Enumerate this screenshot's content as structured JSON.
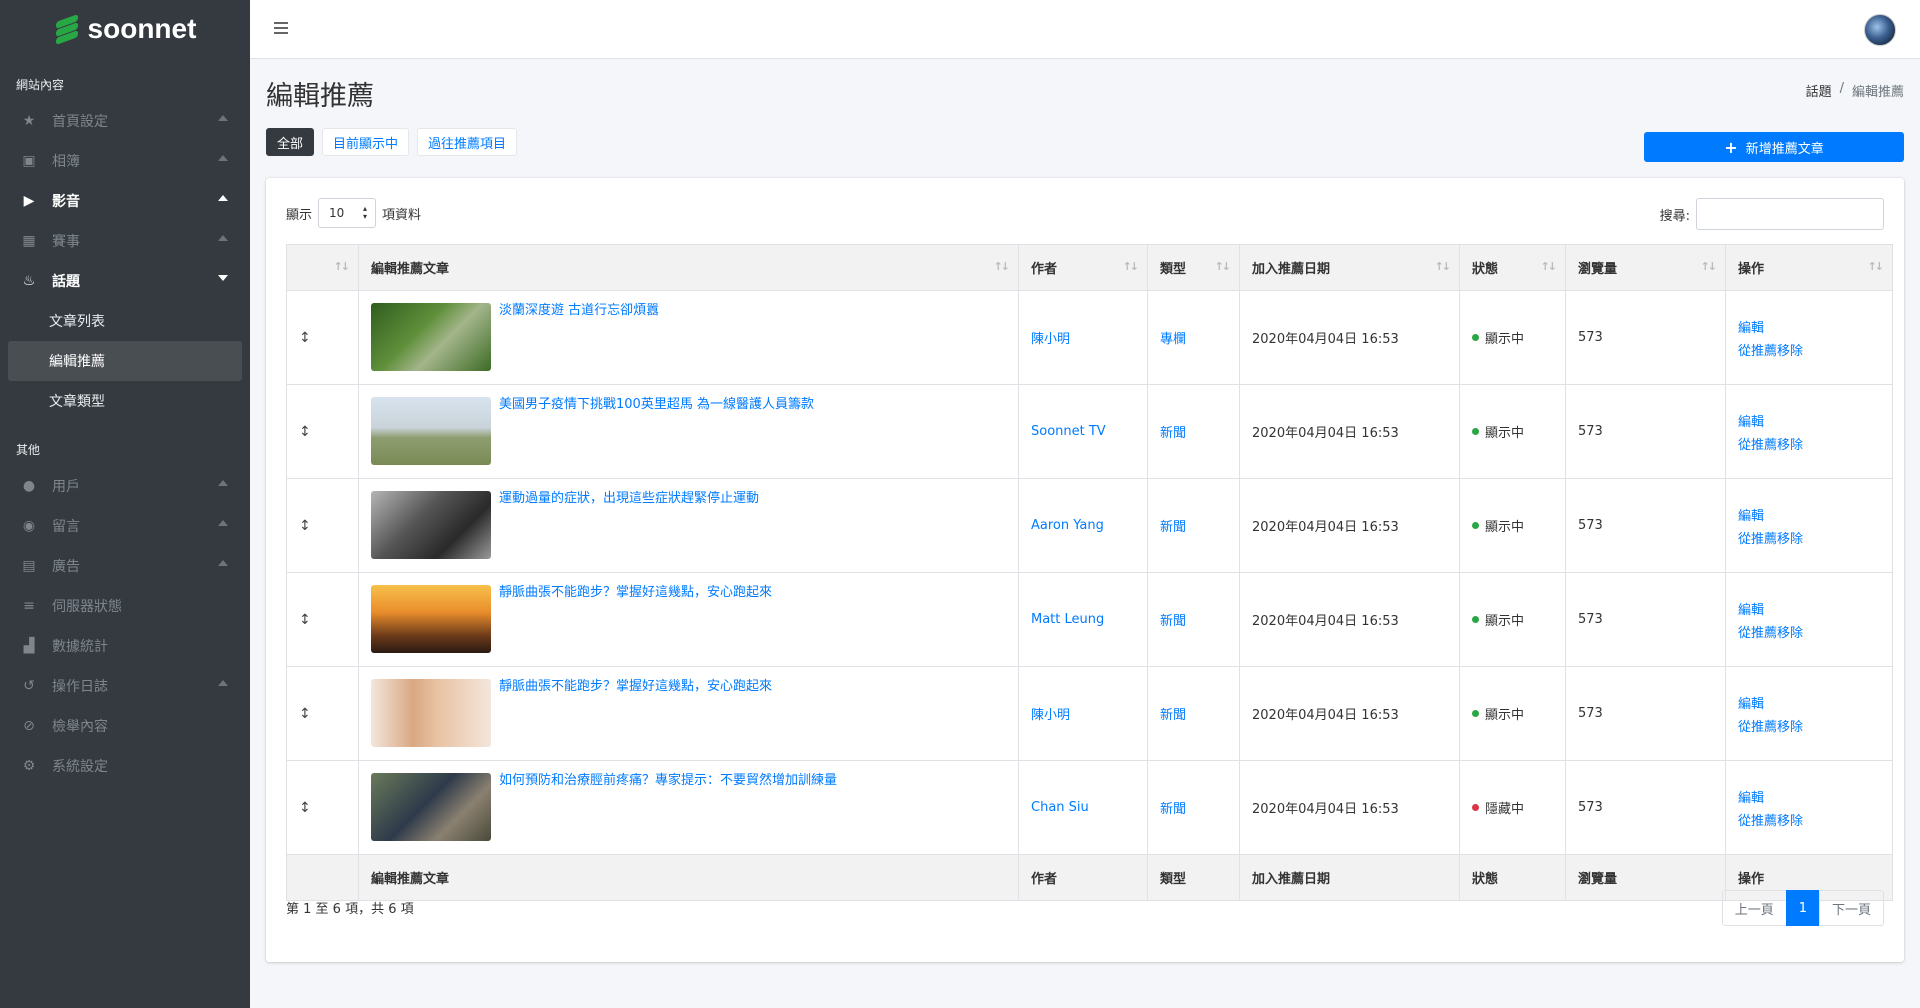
{
  "brand": {
    "name": "soonnet"
  },
  "sidebar": {
    "section1": "網站內容",
    "items1": [
      {
        "label": "首頁設定",
        "icon": "star-icon"
      },
      {
        "label": "相簿",
        "icon": "photos-icon"
      },
      {
        "label": "影音",
        "icon": "play-circle-icon"
      },
      {
        "label": "賽事",
        "icon": "calendar-icon"
      },
      {
        "label": "話題",
        "icon": "fire-icon"
      }
    ],
    "sub": [
      {
        "label": "文章列表"
      },
      {
        "label": "編輯推薦"
      },
      {
        "label": "文章類型"
      }
    ],
    "section2": "其他",
    "items2": [
      {
        "label": "用戶",
        "icon": "user-icon"
      },
      {
        "label": "留言",
        "icon": "comment-icon"
      },
      {
        "label": "廣告",
        "icon": "ad-icon"
      },
      {
        "label": "伺服器狀態",
        "icon": "server-icon"
      },
      {
        "label": "數據統計",
        "icon": "chart-icon"
      },
      {
        "label": "操作日誌",
        "icon": "history-icon"
      },
      {
        "label": "檢舉內容",
        "icon": "ban-icon"
      },
      {
        "label": "系統設定",
        "icon": "gear-icon"
      }
    ]
  },
  "page": {
    "title": "編輯推薦",
    "breadcrumb": [
      "話題",
      "編輯推薦"
    ]
  },
  "filters": [
    "全部",
    "目前顯示中",
    "過往推薦項目"
  ],
  "add_button": "新增推薦文章",
  "table_controls": {
    "show_prefix": "顯示",
    "page_size": "10",
    "show_suffix": "項資料",
    "search_label": "搜尋:"
  },
  "columns": [
    "",
    "編輯推薦文章",
    "作者",
    "類型",
    "加入推薦日期",
    "狀態",
    "瀏覽量",
    "操作"
  ],
  "rows": [
    {
      "title": "淡蘭深度遊 古道行忘卻煩囂",
      "author": "陳小明",
      "type": "專欄",
      "date": "2020年04月04日 16:53",
      "status": "顯示中",
      "status_color": "#28a745",
      "views": "573",
      "edit": "編輯",
      "remove": "從推薦移除"
    },
    {
      "title": "美國男子疫情下挑戰100英里超馬 為一線醫護人員籌款",
      "author": "Soonnet TV",
      "type": "新聞",
      "date": "2020年04月04日 16:53",
      "status": "顯示中",
      "status_color": "#28a745",
      "views": "573",
      "edit": "編輯",
      "remove": "從推薦移除"
    },
    {
      "title": "運動過量的症狀，出現這些症狀趕緊停止運動",
      "author": "Aaron Yang",
      "type": "新聞",
      "date": "2020年04月04日 16:53",
      "status": "顯示中",
      "status_color": "#28a745",
      "views": "573",
      "edit": "編輯",
      "remove": "從推薦移除"
    },
    {
      "title": "靜脈曲張不能跑步？掌握好這幾點，安心跑起來",
      "author": "Matt Leung",
      "type": "新聞",
      "date": "2020年04月04日 16:53",
      "status": "顯示中",
      "status_color": "#28a745",
      "views": "573",
      "edit": "編輯",
      "remove": "從推薦移除"
    },
    {
      "title": "靜脈曲張不能跑步？掌握好這幾點，安心跑起來",
      "author": "陳小明",
      "type": "新聞",
      "date": "2020年04月04日 16:53",
      "status": "顯示中",
      "status_color": "#28a745",
      "views": "573",
      "edit": "編輯",
      "remove": "從推薦移除"
    },
    {
      "title": "如何預防和治療脛前疼痛？專家提示：不要貿然增加訓練量",
      "author": "Chan Siu",
      "type": "新聞",
      "date": "2020年04月04日 16:53",
      "status": "隱藏中",
      "status_color": "#dc3545",
      "views": "573",
      "edit": "編輯",
      "remove": "從推薦移除"
    }
  ],
  "footer": {
    "info": "第 1 至 6 項，共 6 項",
    "prev": "上一頁",
    "page": "1",
    "next": "下一頁"
  }
}
